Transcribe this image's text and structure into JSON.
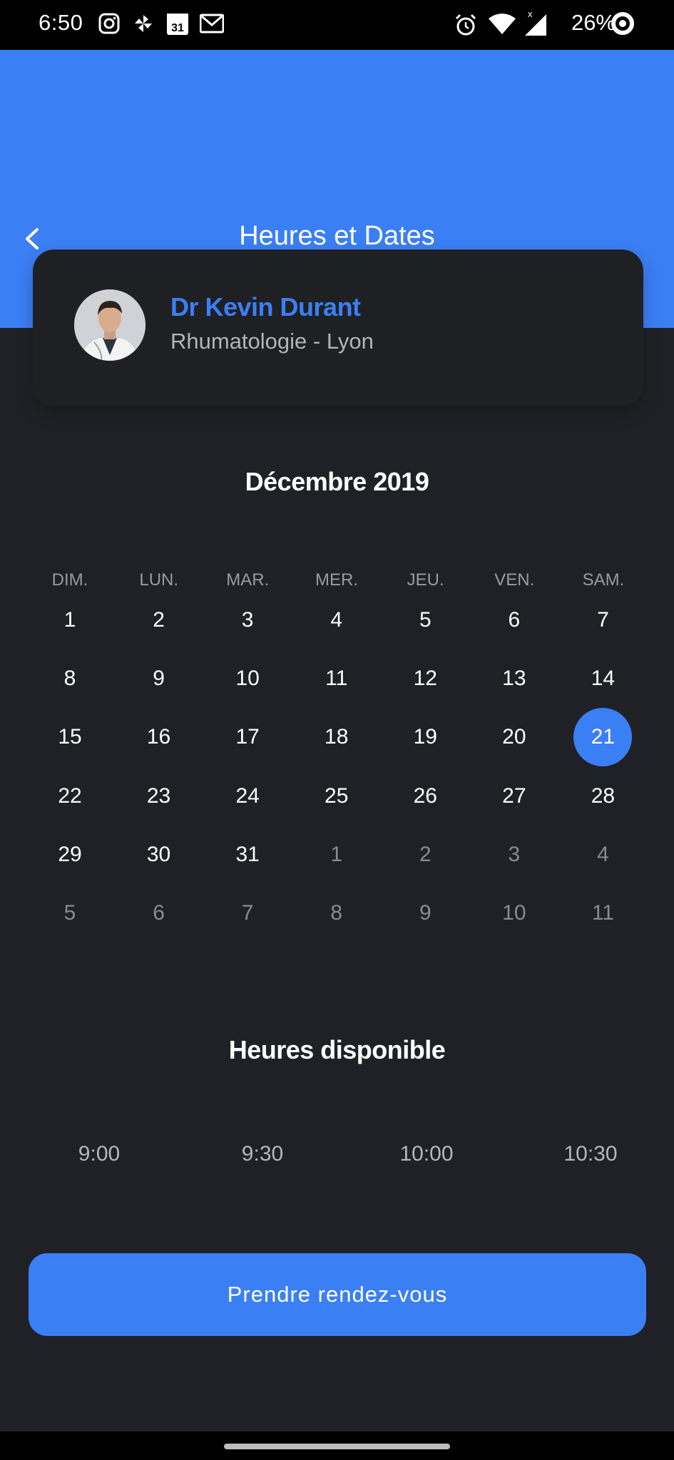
{
  "status_bar": {
    "time": "6:50",
    "battery": "26%",
    "icons": [
      "instagram-icon",
      "pinwheel-icon",
      "calendar-31-icon",
      "gmail-icon",
      "alarm-icon",
      "wifi-icon",
      "signal-icon",
      "battery-ring-icon"
    ],
    "calendar_icon_label": "31",
    "signal_label": "x"
  },
  "header": {
    "title": "Heures et Dates",
    "back_icon": "chevron-left-icon",
    "color": "#3b7ff5"
  },
  "doctor": {
    "name": "Dr Kevin Durant",
    "specialty": "Rhumatologie - Lyon",
    "name_color": "#3b7ff5"
  },
  "calendar": {
    "month": "Décembre 2019",
    "weekdays": [
      "DIM.",
      "LUN.",
      "MAR.",
      "MER.",
      "JEU.",
      "VEN.",
      "SAM."
    ],
    "days": [
      "1",
      "2",
      "3",
      "4",
      "5",
      "6",
      "7",
      "8",
      "9",
      "10",
      "11",
      "12",
      "13",
      "14",
      "15",
      "16",
      "17",
      "18",
      "19",
      "20",
      "21",
      "22",
      "23",
      "24",
      "25",
      "26",
      "27",
      "28",
      "29",
      "30",
      "31",
      "1",
      "2",
      "3",
      "4",
      "5",
      "6",
      "7",
      "8",
      "9",
      "10",
      "11"
    ],
    "current_month_day_count": 31,
    "selected_day": "21",
    "selected_color": "#3b7ff5"
  },
  "hours": {
    "title": "Heures disponible",
    "slots": [
      "9:00",
      "9:30",
      "10:00",
      "10:30"
    ]
  },
  "cta": {
    "label": "Prendre rendez-vous",
    "color": "#3b7ff5"
  },
  "background_color": "#202126"
}
